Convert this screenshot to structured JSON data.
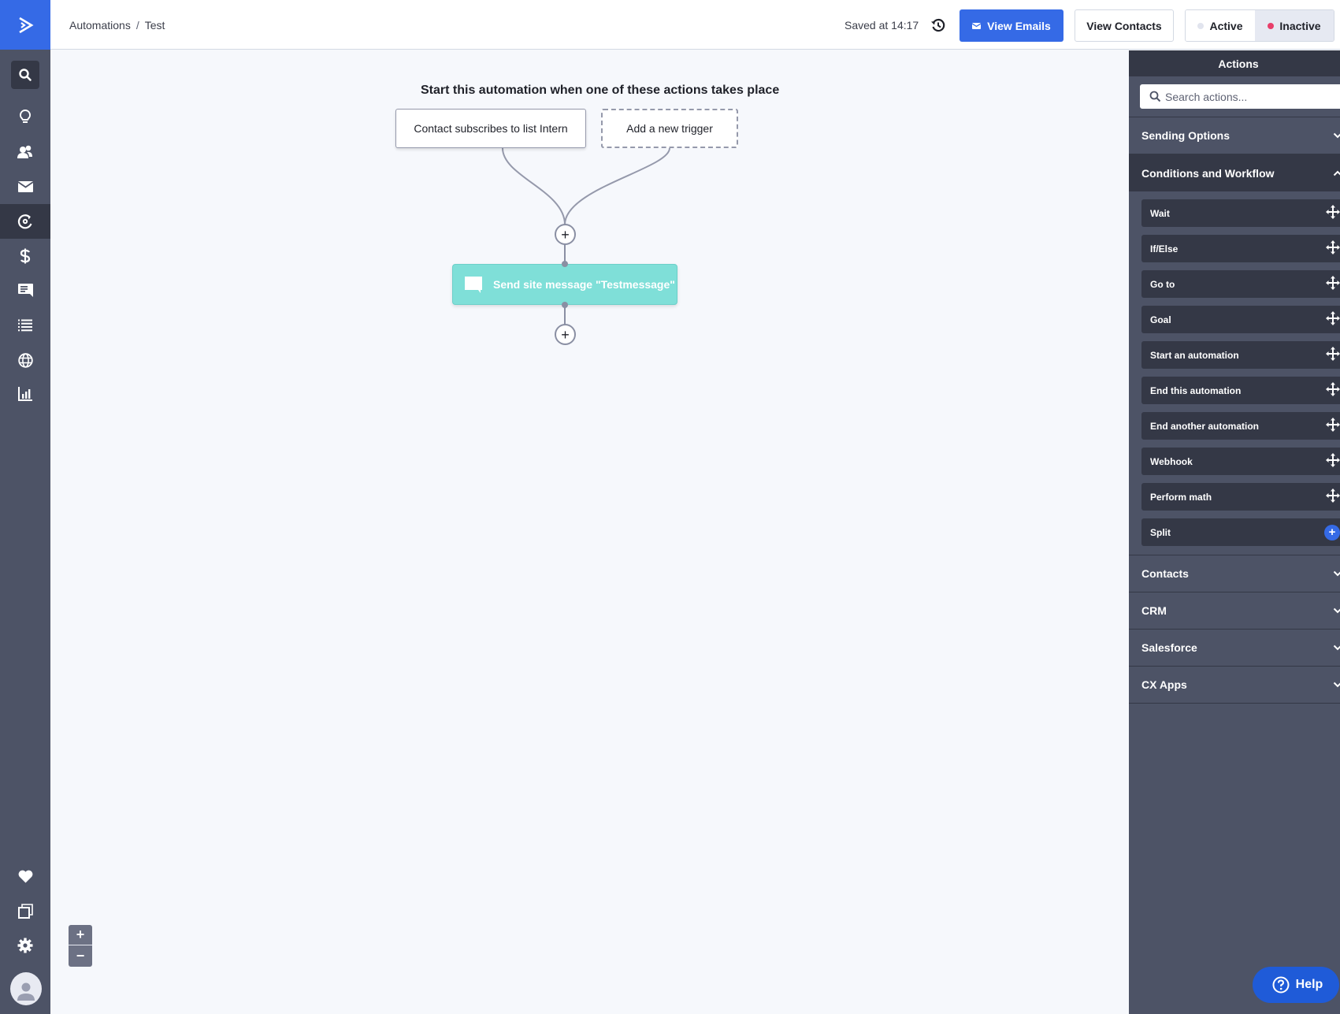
{
  "app": {
    "brand_color": "#356ae6",
    "nav_color": "#4d5366",
    "nav_active_color": "#343846"
  },
  "nav": {
    "logo": "activecampaign-logo",
    "items": [
      {
        "name": "search",
        "icon": "search-icon"
      },
      {
        "name": "ideas",
        "icon": "lightbulb-icon"
      },
      {
        "name": "contacts",
        "icon": "contacts-icon"
      },
      {
        "name": "campaigns",
        "icon": "mail-icon"
      },
      {
        "name": "automations",
        "icon": "automation-icon",
        "active": true
      },
      {
        "name": "deals",
        "icon": "dollar-icon"
      },
      {
        "name": "conversations",
        "icon": "chat-icon"
      },
      {
        "name": "lists",
        "icon": "list-icon"
      },
      {
        "name": "website",
        "icon": "globe-icon"
      },
      {
        "name": "reports",
        "icon": "bar-chart-icon"
      }
    ],
    "bottom_items": [
      {
        "name": "favorites",
        "icon": "heart-icon"
      },
      {
        "name": "apps",
        "icon": "copy-icon"
      },
      {
        "name": "settings",
        "icon": "gear-icon"
      },
      {
        "name": "account",
        "icon": "avatar-icon"
      }
    ]
  },
  "header": {
    "breadcrumb": [
      "Automations",
      "Test"
    ],
    "breadcrumb_sep": "/",
    "saved_text": "Saved at 14:17",
    "view_emails_label": "View Emails",
    "view_contacts_label": "View Contacts",
    "status_toggle": {
      "options": [
        {
          "label": "Active",
          "dot_color": "#e1e4ee"
        },
        {
          "label": "Inactive",
          "dot_color": "#e83e6a"
        }
      ],
      "selected": "Inactive"
    }
  },
  "canvas": {
    "title": "Start this automation when one of these actions takes place",
    "triggers": [
      {
        "label": "Contact subscribes to list Intern"
      },
      {
        "label": "Add a new trigger",
        "placeholder": true
      }
    ],
    "add_step_symbol": "+",
    "actions": [
      {
        "label": "Send site message \"Testmessage\"",
        "icon": "site-message-icon",
        "color": "#7fdfd8"
      }
    ],
    "zoom_in": "+",
    "zoom_out": "−"
  },
  "panel": {
    "title": "Actions",
    "search_placeholder": "Search actions...",
    "sections": [
      {
        "label": "Sending Options",
        "open": false
      },
      {
        "label": "Conditions and Workflow",
        "open": true
      },
      {
        "label": "Contacts",
        "open": false
      },
      {
        "label": "CRM",
        "open": false
      },
      {
        "label": "Salesforce",
        "open": false
      },
      {
        "label": "CX Apps",
        "open": false
      }
    ],
    "workflow_actions": [
      {
        "label": "Wait",
        "handle": "move-icon"
      },
      {
        "label": "If/Else",
        "handle": "move-icon"
      },
      {
        "label": "Go to",
        "handle": "move-icon"
      },
      {
        "label": "Goal",
        "handle": "move-icon"
      },
      {
        "label": "Start an automation",
        "handle": "move-icon"
      },
      {
        "label": "End this automation",
        "handle": "move-icon"
      },
      {
        "label": "End another automation",
        "handle": "move-icon"
      },
      {
        "label": "Webhook",
        "handle": "move-icon"
      },
      {
        "label": "Perform math",
        "handle": "move-icon"
      },
      {
        "label": "Split",
        "handle": "plus-icon"
      }
    ]
  },
  "help": {
    "label": "Help"
  }
}
